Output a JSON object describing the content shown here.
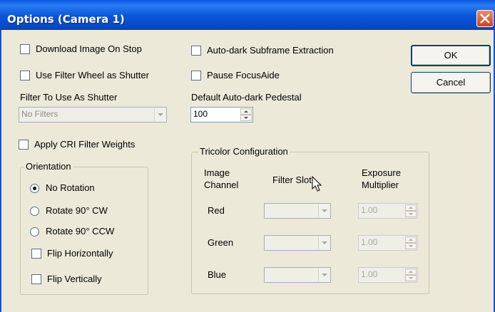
{
  "window": {
    "title": "Options (Camera 1)"
  },
  "buttons": {
    "ok": "OK",
    "cancel": "Cancel"
  },
  "left": {
    "download_image_on_stop": "Download Image On Stop",
    "use_filter_wheel_as_shutter": "Use Filter Wheel as Shutter",
    "filter_to_use_label": "Filter To Use As Shutter",
    "filter_to_use_value": "No Filters",
    "apply_cri_filter_weights": "Apply CRI Filter Weights"
  },
  "middle": {
    "auto_dark_subframe": "Auto-dark Subframe Extraction",
    "pause_focusaide": "Pause FocusAide",
    "pedestal_label": "Default Auto-dark Pedestal",
    "pedestal_value": "100"
  },
  "orientation": {
    "title": "Orientation",
    "selected": "No Rotation",
    "options": [
      "No Rotation",
      "Rotate 90° CW",
      "Rotate 90° CCW"
    ],
    "flip_horizontal": "Flip Horizontally",
    "flip_vertical": "Flip Vertically"
  },
  "tricolor": {
    "title": "Tricolor Configuration",
    "col_channel": "Image\nChannel",
    "col_channel_1": "Image",
    "col_channel_2": "Channel",
    "col_filter": "Filter Slot",
    "col_exposure_1": "Exposure",
    "col_exposure_2": "Multiplier",
    "rows": [
      {
        "channel": "Red",
        "multiplier": "1.00"
      },
      {
        "channel": "Green",
        "multiplier": "1.00"
      },
      {
        "channel": "Blue",
        "multiplier": "1.00"
      }
    ]
  }
}
